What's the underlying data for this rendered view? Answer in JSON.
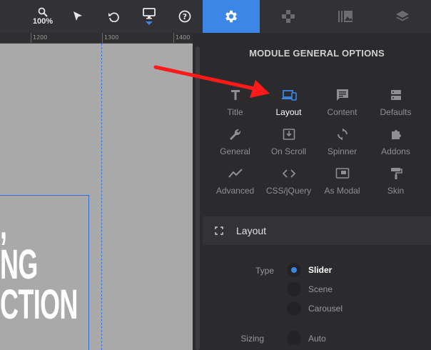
{
  "toolbar": {
    "zoom_label": "100%",
    "tools": [
      "zoom-icon",
      "select-arrow-icon",
      "undo-icon",
      "desktop-icon",
      "help-icon"
    ]
  },
  "ruler": {
    "ticks": [
      "1200",
      "1300",
      "1400"
    ]
  },
  "canvas": {
    "text_lines": [
      ",",
      "NG",
      "CTION"
    ]
  },
  "panel": {
    "tabs": [
      "gear-icon",
      "puzzle-icon",
      "gallery-icon",
      "layers-icon"
    ],
    "title": "MODULE GENERAL OPTIONS",
    "options": [
      {
        "label": "Title",
        "icon": "title-icon"
      },
      {
        "label": "Layout",
        "icon": "layout-icon",
        "active": true
      },
      {
        "label": "Content",
        "icon": "content-icon"
      },
      {
        "label": "Defaults",
        "icon": "defaults-icon"
      },
      {
        "label": "General",
        "icon": "wrench-icon"
      },
      {
        "label": "On Scroll",
        "icon": "scroll-icon"
      },
      {
        "label": "Spinner",
        "icon": "spinner-icon"
      },
      {
        "label": "Addons",
        "icon": "addons-icon"
      },
      {
        "label": "Advanced",
        "icon": "advanced-icon"
      },
      {
        "label": "CSS/jQuery",
        "icon": "code-icon"
      },
      {
        "label": "As Modal",
        "icon": "modal-icon"
      },
      {
        "label": "Skin",
        "icon": "skin-icon"
      }
    ],
    "section_title": "Layout",
    "type_label": "Type",
    "type_options": [
      "Slider",
      "Scene",
      "Carousel"
    ],
    "type_selected": "Slider",
    "sizing_label": "Sizing",
    "sizing_options": [
      "Auto"
    ]
  },
  "colors": {
    "accent": "#3c86e6",
    "annotation": "#ff1a1a"
  }
}
